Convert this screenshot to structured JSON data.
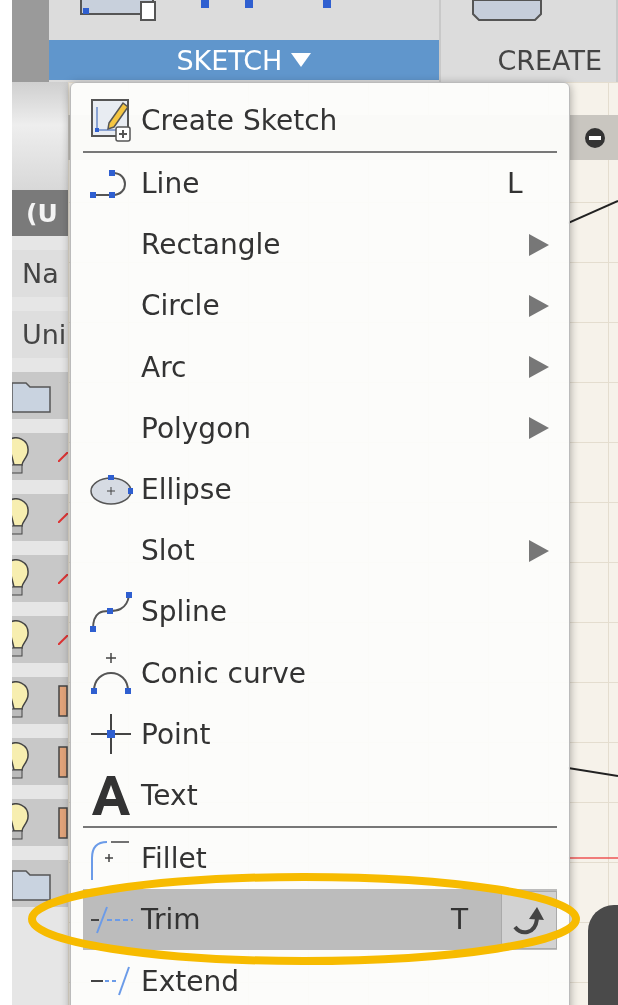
{
  "toolbar": {
    "tabs": [
      {
        "label": "SKETCH",
        "selected": true,
        "dropdown": true
      },
      {
        "label": "CREATE",
        "selected": false,
        "dropdown": false
      }
    ]
  },
  "browser": {
    "title": "(U",
    "rows": [
      {
        "kind": "text",
        "label": "Na"
      },
      {
        "kind": "text",
        "label": "Uni"
      },
      {
        "kind": "folder"
      },
      {
        "kind": "sketch"
      },
      {
        "kind": "sketch"
      },
      {
        "kind": "sketch"
      },
      {
        "kind": "sketch"
      },
      {
        "kind": "body"
      },
      {
        "kind": "body"
      },
      {
        "kind": "body"
      },
      {
        "kind": "folder"
      }
    ]
  },
  "menu": {
    "items": [
      {
        "kind": "sketch",
        "label": "Create Sketch",
        "submenu": false,
        "selected": false
      },
      {
        "kind": "divider"
      },
      {
        "kind": "line",
        "label": "Line",
        "shortcut": "L",
        "submenu": false,
        "selected": false
      },
      {
        "kind": "plain",
        "label": "Rectangle",
        "submenu": true,
        "selected": false
      },
      {
        "kind": "plain",
        "label": "Circle",
        "submenu": true,
        "selected": false
      },
      {
        "kind": "plain",
        "label": "Arc",
        "submenu": true,
        "selected": false
      },
      {
        "kind": "plain",
        "label": "Polygon",
        "submenu": true,
        "selected": false
      },
      {
        "kind": "ellipse",
        "label": "Ellipse",
        "submenu": false,
        "selected": false
      },
      {
        "kind": "plain",
        "label": "Slot",
        "submenu": true,
        "selected": false
      },
      {
        "kind": "spline",
        "label": "Spline",
        "submenu": false,
        "selected": false
      },
      {
        "kind": "conic",
        "label": "Conic curve",
        "submenu": false,
        "selected": false
      },
      {
        "kind": "point",
        "label": "Point",
        "submenu": false,
        "selected": false
      },
      {
        "kind": "text",
        "label": "Text",
        "submenu": false,
        "selected": false
      },
      {
        "kind": "divider"
      },
      {
        "kind": "fillet",
        "label": "Fillet",
        "submenu": false,
        "selected": false
      },
      {
        "kind": "trim",
        "label": "Trim",
        "shortcut": "T",
        "submenu": false,
        "selected": true,
        "repeat_button": true
      },
      {
        "kind": "extend",
        "label": "Extend",
        "submenu": false,
        "selected": false
      }
    ]
  },
  "annotation": {
    "kind": "ellipse"
  }
}
